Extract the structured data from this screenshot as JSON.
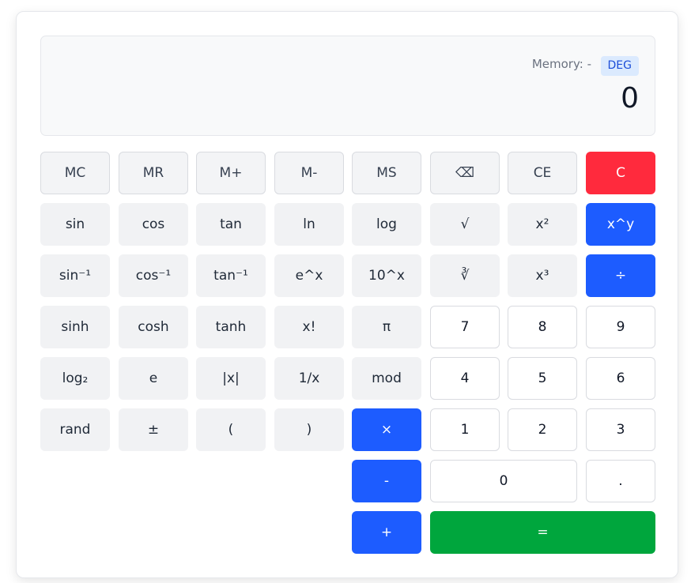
{
  "display": {
    "memory_label": "Memory: -",
    "mode": "DEG",
    "value": "0"
  },
  "buttons": {
    "mc": "MC",
    "mr": "MR",
    "mplus": "M+",
    "mminus": "M-",
    "ms": "MS",
    "backspace": "⌫",
    "ce": "CE",
    "c": "C",
    "sin": "sin",
    "cos": "cos",
    "tan": "tan",
    "ln": "ln",
    "log": "log",
    "sqrt": "√",
    "square": "x²",
    "pow": "x^y",
    "asin": "sin⁻¹",
    "acos": "cos⁻¹",
    "atan": "tan⁻¹",
    "exp": "e^x",
    "pow10": "10^x",
    "cbrt": "∛",
    "cube": "x³",
    "divide": "÷",
    "sinh": "sinh",
    "cosh": "cosh",
    "tanh": "tanh",
    "factorial": "x!",
    "pi": "π",
    "seven": "7",
    "eight": "8",
    "nine": "9",
    "log2": "log₂",
    "e": "e",
    "abs": "|x|",
    "reciprocal": "1/x",
    "mod": "mod",
    "four": "4",
    "five": "5",
    "six": "6",
    "rand": "rand",
    "negate": "±",
    "lparen": "(",
    "rparen": ")",
    "multiply": "×",
    "one": "1",
    "two": "2",
    "three": "3",
    "subtract": "-",
    "zero": "0",
    "decimal": ".",
    "add": "+",
    "equals": "="
  },
  "colors": {
    "operator": "#1d5cff",
    "clear": "#ff2a3d",
    "equals": "#00a63d",
    "mode_badge": "#dbeafe"
  }
}
